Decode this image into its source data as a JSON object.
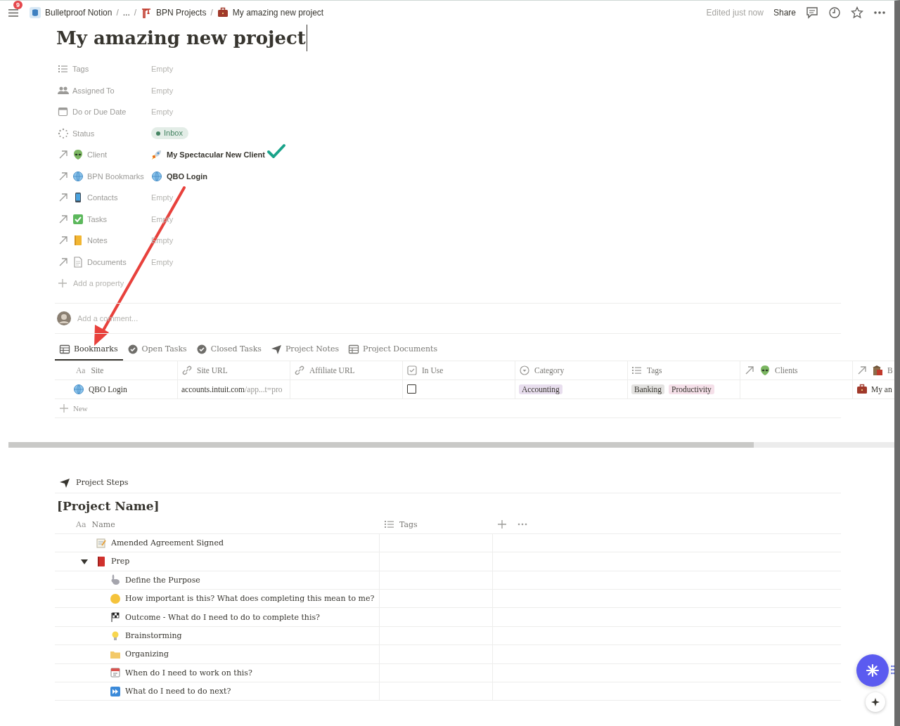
{
  "topbar": {
    "notification_count": "9",
    "breadcrumbs": [
      {
        "label": "Bulletproof Notion"
      },
      {
        "label": "..."
      },
      {
        "label": "BPN Projects"
      },
      {
        "label": "My amazing new project"
      }
    ],
    "separator": "/",
    "edited": "Edited just now",
    "share": "Share"
  },
  "title": "My amazing new project",
  "properties": [
    {
      "kind": "multi_select",
      "label": "Tags",
      "value": "Empty"
    },
    {
      "kind": "person",
      "label": "Assigned To",
      "value": "Empty"
    },
    {
      "kind": "date",
      "label": "Do or Due Date",
      "value": "Empty"
    },
    {
      "kind": "status",
      "label": "Status",
      "value": "Inbox",
      "color": "#448361"
    },
    {
      "kind": "relation",
      "label": "Client",
      "value": "My Spectacular New Client"
    },
    {
      "kind": "relation",
      "label": "BPN Bookmarks",
      "value": "QBO Login"
    },
    {
      "kind": "relation",
      "label": "Contacts",
      "value": "Empty"
    },
    {
      "kind": "relation",
      "label": "Tasks",
      "value": "Empty"
    },
    {
      "kind": "relation",
      "label": "Notes",
      "value": "Empty"
    },
    {
      "kind": "relation",
      "label": "Documents",
      "value": "Empty"
    }
  ],
  "add_property": "Add a property",
  "comment": {
    "placeholder": "Add a comment..."
  },
  "views": [
    {
      "label": "Bookmarks",
      "selected": true
    },
    {
      "label": "Open Tasks",
      "selected": false
    },
    {
      "label": "Closed Tasks",
      "selected": false
    },
    {
      "label": "Project Notes",
      "selected": false
    },
    {
      "label": "Project Documents",
      "selected": false
    }
  ],
  "bookmarks": {
    "columns": [
      {
        "kind": "title",
        "prefix": "Aa",
        "label": "Site"
      },
      {
        "kind": "url",
        "label": "Site URL"
      },
      {
        "kind": "url",
        "label": "Affiliate URL"
      },
      {
        "kind": "checkbox",
        "label": "In Use"
      },
      {
        "kind": "select",
        "label": "Category"
      },
      {
        "kind": "multi_select",
        "label": "Tags"
      },
      {
        "kind": "relation",
        "label": "Clients"
      },
      {
        "kind": "relation",
        "label": "B"
      }
    ],
    "rows": [
      {
        "site": "QBO Login",
        "url_host": "accounts.intuit.com",
        "url_rest": "/app...t=pro",
        "in_use": false,
        "category": {
          "label": "Accounting",
          "color": "#e8deee"
        },
        "tags": [
          {
            "label": "Banking",
            "color": "#e3e2e0"
          },
          {
            "label": "Productivity",
            "color": "#f5e0e9"
          }
        ],
        "project": "My an"
      }
    ],
    "new_label": "New"
  },
  "steps": {
    "header": "Project Steps",
    "title": "[Project Name]",
    "columns": [
      {
        "prefix": "Aa",
        "label": "Name"
      },
      {
        "label": "Tags"
      }
    ],
    "rows": [
      {
        "name": "Amended Agreement Signed"
      },
      {
        "name": "Prep",
        "expanded": true,
        "children": [
          {
            "name": "Define the Purpose"
          },
          {
            "name": "How important is this? What does completing this mean to me?"
          },
          {
            "name": "Outcome - What do I need to do to complete this?"
          },
          {
            "name": "Brainstorming"
          },
          {
            "name": "Organizing"
          },
          {
            "name": "When do I need to work on this?"
          },
          {
            "name": "What do I need to do next?"
          }
        ]
      }
    ]
  }
}
